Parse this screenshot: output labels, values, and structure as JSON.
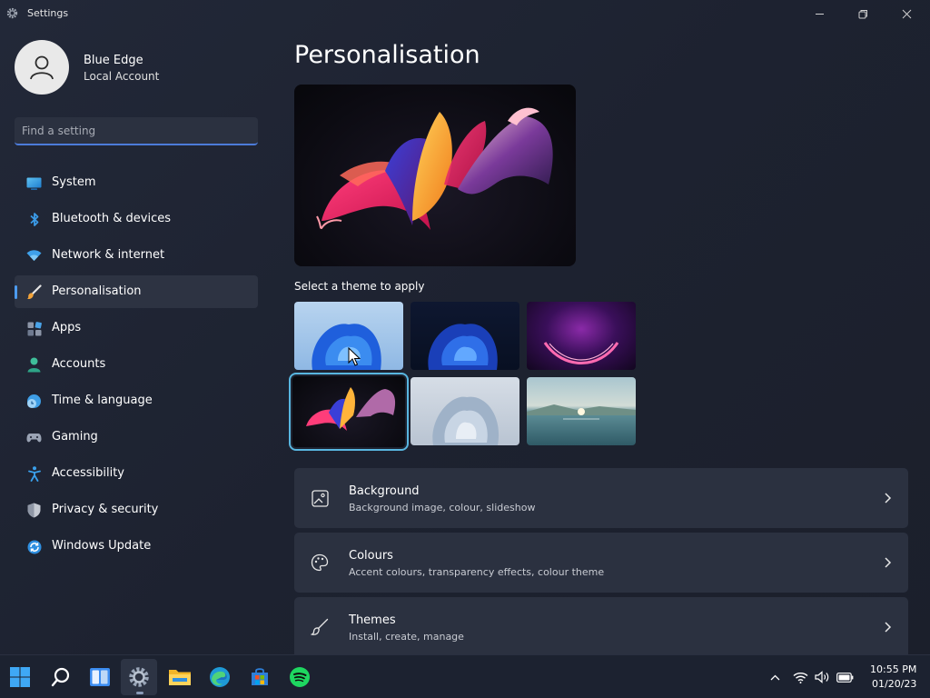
{
  "window": {
    "title": "Settings",
    "icon": "gear-icon"
  },
  "user": {
    "name": "Blue Edge",
    "account_type": "Local Account"
  },
  "search": {
    "placeholder": "Find a setting"
  },
  "sidebar": {
    "items": [
      {
        "label": "System",
        "icon": "monitor-icon"
      },
      {
        "label": "Bluetooth & devices",
        "icon": "bluetooth-icon"
      },
      {
        "label": "Network & internet",
        "icon": "wifi-icon"
      },
      {
        "label": "Personalisation",
        "icon": "paintbrush-icon",
        "active": true
      },
      {
        "label": "Apps",
        "icon": "apps-icon"
      },
      {
        "label": "Accounts",
        "icon": "person-icon"
      },
      {
        "label": "Time & language",
        "icon": "clock-globe-icon"
      },
      {
        "label": "Gaming",
        "icon": "gamepad-icon"
      },
      {
        "label": "Accessibility",
        "icon": "accessibility-icon"
      },
      {
        "label": "Privacy & security",
        "icon": "shield-icon"
      },
      {
        "label": "Windows Update",
        "icon": "refresh-icon"
      }
    ]
  },
  "main": {
    "title": "Personalisation",
    "themes_label": "Select a theme to apply",
    "themes": [
      {
        "name": "windows-light",
        "selected": false
      },
      {
        "name": "windows-dark",
        "selected": false
      },
      {
        "name": "glow",
        "selected": false
      },
      {
        "name": "captured-motion",
        "selected": true
      },
      {
        "name": "sunrise",
        "selected": false
      },
      {
        "name": "flow",
        "selected": false
      }
    ],
    "cards": [
      {
        "title": "Background",
        "subtitle": "Background image, colour, slideshow",
        "icon": "image-icon"
      },
      {
        "title": "Colours",
        "subtitle": "Accent colours, transparency effects, colour theme",
        "icon": "palette-icon"
      },
      {
        "title": "Themes",
        "subtitle": "Install, create, manage",
        "icon": "brush-icon"
      }
    ]
  },
  "taskbar": {
    "apps": [
      "start-icon",
      "search-icon",
      "widgets-icon",
      "settings-icon",
      "file-explorer-icon",
      "edge-icon",
      "store-icon",
      "spotify-icon"
    ],
    "active_app": "settings-icon",
    "time": "10:55 PM",
    "date": "01/20/23"
  },
  "colors": {
    "accent": "#4c9bef",
    "selected_outline": "#58b6e0",
    "card_bg": "#2b3140"
  }
}
